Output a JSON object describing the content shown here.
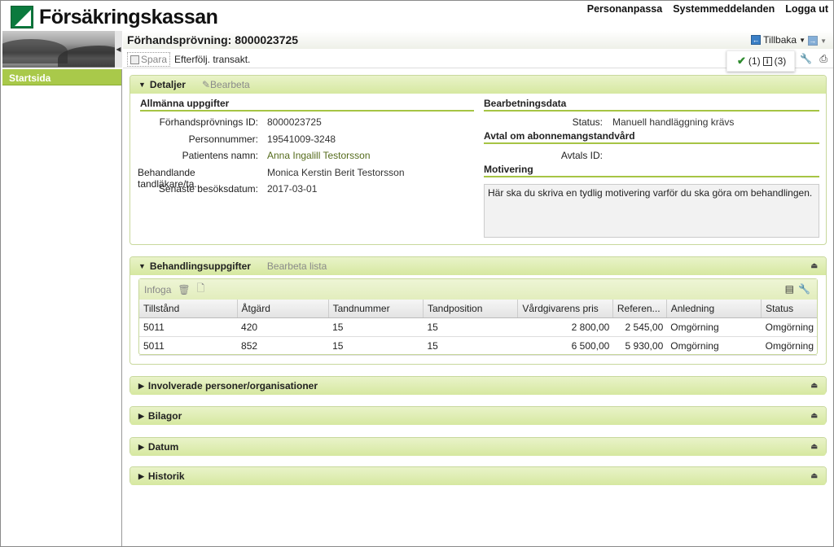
{
  "header": {
    "brand": "Försäkringskassan",
    "nav": [
      "Personanpassa",
      "Systemmeddelanden",
      "Logga ut"
    ]
  },
  "sidebar": {
    "items": [
      {
        "label": "Startsida"
      }
    ]
  },
  "titlebar": {
    "title": "Förhandsprövning: 8000023725",
    "back_label": "Tillbaka"
  },
  "toolbar": {
    "save_label": "Spara",
    "followup_label": "Efterfölj. transakt.",
    "messages": {
      "ok_count": "(1)",
      "info_count": "(3)"
    }
  },
  "details": {
    "header": "Detaljer",
    "edit_label": "Bearbeta",
    "general": {
      "title": "Allmänna uppgifter",
      "fields": [
        {
          "label": "Förhandsprövnings ID:",
          "value": "8000023725"
        },
        {
          "label": "Personnummer:",
          "value": "19541009-3248"
        },
        {
          "label": "Patientens namn:",
          "value": "Anna Ingalill Testorsson"
        },
        {
          "label": "Behandlande tandläkare/ta...",
          "value": "Monica Kerstin Berit Testorsson"
        },
        {
          "label": "Senaste besöksdatum:",
          "value": "2017-03-01"
        }
      ]
    },
    "processing": {
      "title": "Bearbetningsdata",
      "status_label": "Status:",
      "status_value": "Manuell handläggning krävs"
    },
    "agreement": {
      "title": "Avtal om abonnemangstandvård",
      "id_label": "Avtals ID:",
      "id_value": ""
    },
    "motivation": {
      "title": "Motivering",
      "text": "Här ska du skriva en tydlig motivering varför du ska göra om behandlingen."
    }
  },
  "treatment": {
    "header": "Behandlingsuppgifter",
    "edit_label": "Bearbeta lista",
    "insert_label": "Infoga",
    "columns": [
      "Tillstånd",
      "Åtgärd",
      "Tandnummer",
      "Tandposition",
      "Vårdgivarens pris",
      "Referen...",
      "Anledning",
      "Status"
    ],
    "rows": [
      [
        "5011",
        "420",
        "15",
        "15",
        "2 800,00",
        "2 545,00",
        "Omgörning",
        "Omgörning"
      ],
      [
        "5011",
        "852",
        "15",
        "15",
        "6 500,00",
        "5 930,00",
        "Omgörning",
        "Omgörning"
      ]
    ]
  },
  "collapsed_panels": [
    "Involverade personer/organisationer",
    "Bilagor",
    "Datum",
    "Historik"
  ]
}
